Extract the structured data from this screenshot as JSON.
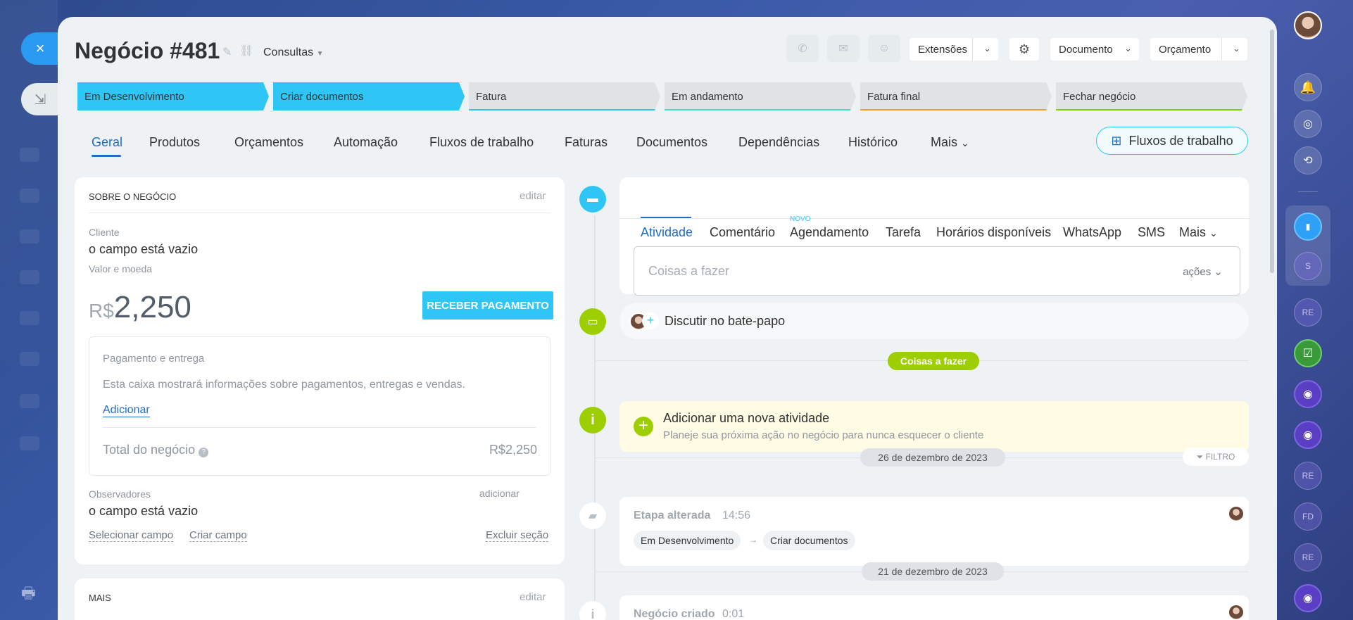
{
  "left_rail": {
    "close_icon": "×",
    "minimize_icon": "⇲",
    "printer_icon": "🖶"
  },
  "header": {
    "title": "Negócio #481",
    "category": "Consultas",
    "buttons": {
      "extensions": "Extensões",
      "document": "Documento",
      "budget": "Orçamento"
    }
  },
  "stages": [
    {
      "label": "Em Desenvolvimento",
      "color": "#2fc6f6",
      "active": true
    },
    {
      "label": "Criar documentos",
      "color": "#2fc6f6",
      "active": true
    },
    {
      "label": "Fatura",
      "color": "#2fc6f6",
      "active": false
    },
    {
      "label": "Em andamento",
      "color": "#47e4c2",
      "active": false
    },
    {
      "label": "Fatura final",
      "color": "#ff9f22",
      "active": false
    },
    {
      "label": "Fechar negócio",
      "color": "#7bd500",
      "active": false
    }
  ],
  "tabs": [
    "Geral",
    "Produtos",
    "Orçamentos",
    "Automação",
    "Fluxos de trabalho",
    "Faturas",
    "Documentos",
    "Dependências",
    "Histórico",
    "Mais"
  ],
  "workflow_button": "Fluxos de trabalho",
  "about": {
    "title": "SOBRE O NEGÓCIO",
    "edit": "editar",
    "client_label": "Cliente",
    "client_value": "o campo está vazio",
    "amount_label": "Valor e moeda",
    "currency": "R$",
    "amount": "2,250",
    "pay_button": "RECEBER PAGAMENTO",
    "payment": {
      "title": "Pagamento e entrega",
      "description": "Esta caixa mostrará informações sobre pagamentos, entregas e vendas.",
      "add": "Adicionar",
      "total_label": "Total do negócio",
      "total_value": "R$2,250"
    },
    "observers_label": "Observadores",
    "observers_add": "adicionar",
    "observers_value": "o campo está vazio",
    "select_field": "Selecionar campo",
    "create_field": "Criar campo",
    "delete_section": "Excluir seção"
  },
  "more_section": {
    "title": "MAIS",
    "edit": "editar"
  },
  "activity": {
    "tabs": [
      "Atividade",
      "Comentário",
      "Agendamento",
      "Tarefa",
      "Horários disponíveis",
      "WhatsApp",
      "SMS",
      "Mais"
    ],
    "new_badge": "NOVO",
    "todo_placeholder": "Coisas a fazer",
    "actions": "ações",
    "chat_label": "Discutir no bate-papo",
    "todo_pill": "Coisas a fazer",
    "add_title": "Adicionar uma nova atividade",
    "add_subtitle": "Planeje sua próxima ação no negócio para nunca esquecer o cliente",
    "date1": "26 de dezembro de 2023",
    "filter": "FILTRO",
    "event1_title": "Etapa alterada",
    "event1_time": "14:56",
    "event1_from": "Em Desenvolvimento",
    "event1_to": "Criar documentos",
    "date2": "21 de dezembro de 2023",
    "event2_title": "Negócio criado",
    "event2_time": "0:01"
  },
  "right_rail": {
    "items": [
      "S",
      "RE",
      "RE",
      "FD",
      "RE"
    ]
  }
}
